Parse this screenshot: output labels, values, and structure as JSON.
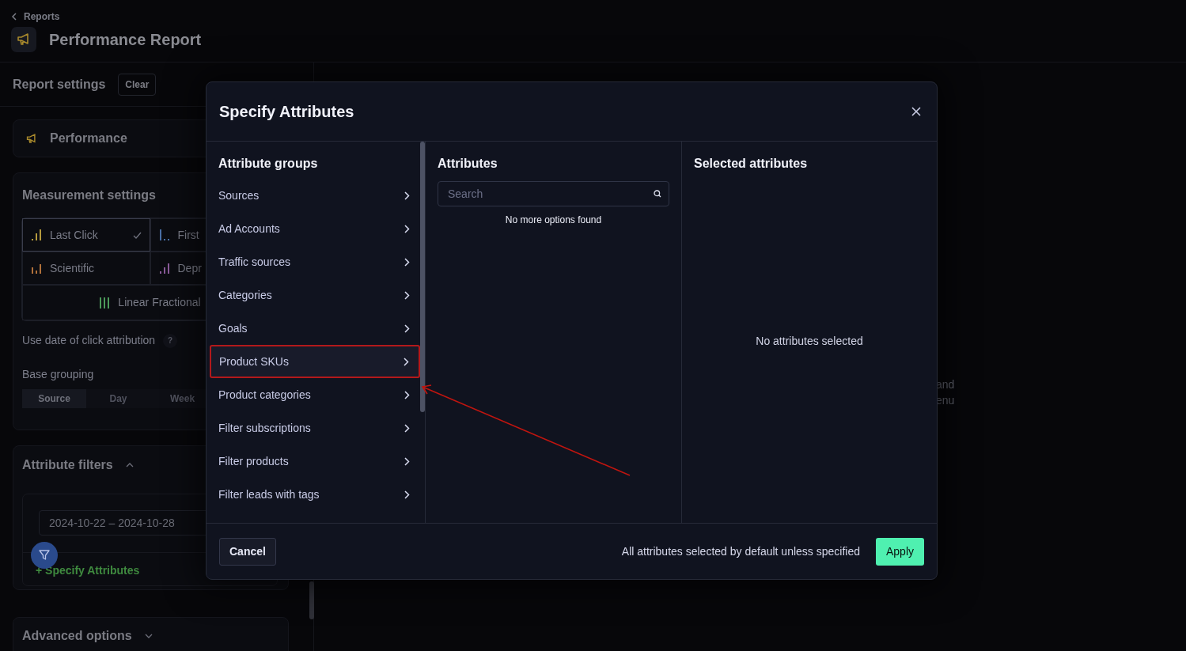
{
  "breadcrumb": {
    "label": "Reports"
  },
  "page_title": "Performance Report",
  "sidebar": {
    "title": "Report settings",
    "clear_button": "Clear",
    "report_type": "Performance",
    "measurement": {
      "title": "Measurement settings",
      "models": [
        {
          "label": "Last Click",
          "color": "#b59a3c",
          "selected": true
        },
        {
          "label": "First",
          "color": "#4a6fa5",
          "selected": false
        },
        {
          "label": "Scientific",
          "color": "#b0703a",
          "selected": false
        },
        {
          "label": "Depr",
          "color": "#8a5a9a",
          "selected": false
        },
        {
          "label": "Linear Fractional",
          "color": "#4c9a5a",
          "selected": false
        }
      ],
      "click_date_label": "Use date of click attribution",
      "help_mark": "?",
      "grouping_label": "Base grouping",
      "grouping": [
        {
          "label": "Source",
          "selected": true
        },
        {
          "label": "Day",
          "selected": false
        },
        {
          "label": "Week",
          "selected": false
        }
      ]
    },
    "filters": {
      "title": "Attribute filters",
      "expanded": true,
      "date_range": "2024-10-22 – 2024-10-28",
      "add_link": "+ Specify Attributes"
    },
    "advanced": {
      "title": "Advanced options",
      "expanded": false
    }
  },
  "main_text": [
    "and",
    "enu"
  ],
  "modal": {
    "title": "Specify Attributes",
    "groups_title": "Attribute groups",
    "groups": [
      {
        "label": "Sources",
        "selected": false
      },
      {
        "label": "Ad Accounts",
        "selected": false
      },
      {
        "label": "Traffic sources",
        "selected": false
      },
      {
        "label": "Categories",
        "selected": false
      },
      {
        "label": "Goals",
        "selected": false
      },
      {
        "label": "Product SKUs",
        "selected": true
      },
      {
        "label": "Product categories",
        "selected": false
      },
      {
        "label": "Filter subscriptions",
        "selected": false
      },
      {
        "label": "Filter products",
        "selected": false
      },
      {
        "label": "Filter leads with tags",
        "selected": false
      }
    ],
    "attributes_title": "Attributes",
    "search": {
      "placeholder": "Search"
    },
    "empty_options": "No more options found",
    "selected_title": "Selected attributes",
    "empty_selected": "No attributes selected",
    "cancel": "Cancel",
    "note": "All attributes selected by default unless specified",
    "apply": "Apply"
  }
}
